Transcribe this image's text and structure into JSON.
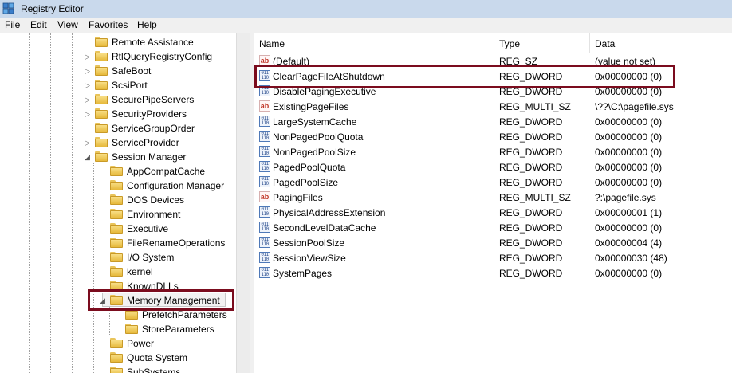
{
  "window": {
    "title": "Registry Editor",
    "icon": "registry-editor-icon"
  },
  "menu": [
    {
      "label": "File",
      "key": "F",
      "rest": "ile"
    },
    {
      "label": "Edit",
      "key": "E",
      "rest": "dit"
    },
    {
      "label": "View",
      "key": "V",
      "rest": "iew"
    },
    {
      "label": "Favorites",
      "key": "F",
      "rest": "avorites"
    },
    {
      "label": "Help",
      "key": "H",
      "rest": "elp"
    }
  ],
  "tree": {
    "items": [
      {
        "label": "Remote Assistance",
        "expander": ""
      },
      {
        "label": "RtlQueryRegistryConfig",
        "expander": "collapsed"
      },
      {
        "label": "SafeBoot",
        "expander": "collapsed"
      },
      {
        "label": "ScsiPort",
        "expander": "collapsed"
      },
      {
        "label": "SecurePipeServers",
        "expander": "collapsed"
      },
      {
        "label": "SecurityProviders",
        "expander": "collapsed"
      },
      {
        "label": "ServiceGroupOrder",
        "expander": ""
      },
      {
        "label": "ServiceProvider",
        "expander": "collapsed"
      },
      {
        "label": "Session Manager",
        "expander": "expanded"
      },
      {
        "label": "AppCompatCache",
        "expander": ""
      },
      {
        "label": "Configuration Manager",
        "expander": ""
      },
      {
        "label": "DOS Devices",
        "expander": ""
      },
      {
        "label": "Environment",
        "expander": ""
      },
      {
        "label": "Executive",
        "expander": ""
      },
      {
        "label": "FileRenameOperations",
        "expander": ""
      },
      {
        "label": "I/O System",
        "expander": ""
      },
      {
        "label": "kernel",
        "expander": ""
      },
      {
        "label": "KnownDLLs",
        "expander": ""
      },
      {
        "label": "Memory Management",
        "expander": "expanded"
      },
      {
        "label": "PrefetchParameters",
        "expander": ""
      },
      {
        "label": "StoreParameters",
        "expander": ""
      },
      {
        "label": "Power",
        "expander": ""
      },
      {
        "label": "Quota System",
        "expander": ""
      },
      {
        "label": "SubSystems",
        "expander": ""
      }
    ],
    "expander_glyphs": {
      "collapsed": "▷",
      "expanded": "◢"
    }
  },
  "list": {
    "columns": [
      "Name",
      "Type",
      "Data"
    ],
    "rows": [
      {
        "name": "(Default)",
        "type": "REG_SZ",
        "data": "(value not set)",
        "icon": "string"
      },
      {
        "name": "ClearPageFileAtShutdown",
        "type": "REG_DWORD",
        "data": "0x00000000 (0)",
        "icon": "binary"
      },
      {
        "name": "DisablePagingExecutive",
        "type": "REG_DWORD",
        "data": "0x00000000 (0)",
        "icon": "binary"
      },
      {
        "name": "ExistingPageFiles",
        "type": "REG_MULTI_SZ",
        "data": "\\??\\C:\\pagefile.sys",
        "icon": "string"
      },
      {
        "name": "LargeSystemCache",
        "type": "REG_DWORD",
        "data": "0x00000000 (0)",
        "icon": "binary"
      },
      {
        "name": "NonPagedPoolQuota",
        "type": "REG_DWORD",
        "data": "0x00000000 (0)",
        "icon": "binary"
      },
      {
        "name": "NonPagedPoolSize",
        "type": "REG_DWORD",
        "data": "0x00000000 (0)",
        "icon": "binary"
      },
      {
        "name": "PagedPoolQuota",
        "type": "REG_DWORD",
        "data": "0x00000000 (0)",
        "icon": "binary"
      },
      {
        "name": "PagedPoolSize",
        "type": "REG_DWORD",
        "data": "0x00000000 (0)",
        "icon": "binary"
      },
      {
        "name": "PagingFiles",
        "type": "REG_MULTI_SZ",
        "data": "?:\\pagefile.sys",
        "icon": "string"
      },
      {
        "name": "PhysicalAddressExtension",
        "type": "REG_DWORD",
        "data": "0x00000001 (1)",
        "icon": "binary"
      },
      {
        "name": "SecondLevelDataCache",
        "type": "REG_DWORD",
        "data": "0x00000000 (0)",
        "icon": "binary"
      },
      {
        "name": "SessionPoolSize",
        "type": "REG_DWORD",
        "data": "0x00000004 (4)",
        "icon": "binary"
      },
      {
        "name": "SessionViewSize",
        "type": "REG_DWORD",
        "data": "0x00000030 (48)",
        "icon": "binary"
      },
      {
        "name": "SystemPages",
        "type": "REG_DWORD",
        "data": "0x00000000 (0)",
        "icon": "binary"
      }
    ]
  },
  "icons": {
    "string": "ab",
    "binary": "011 110"
  },
  "colors": {
    "highlight_box": "#7b0c1e",
    "titlebar": "#c9d9ec"
  }
}
